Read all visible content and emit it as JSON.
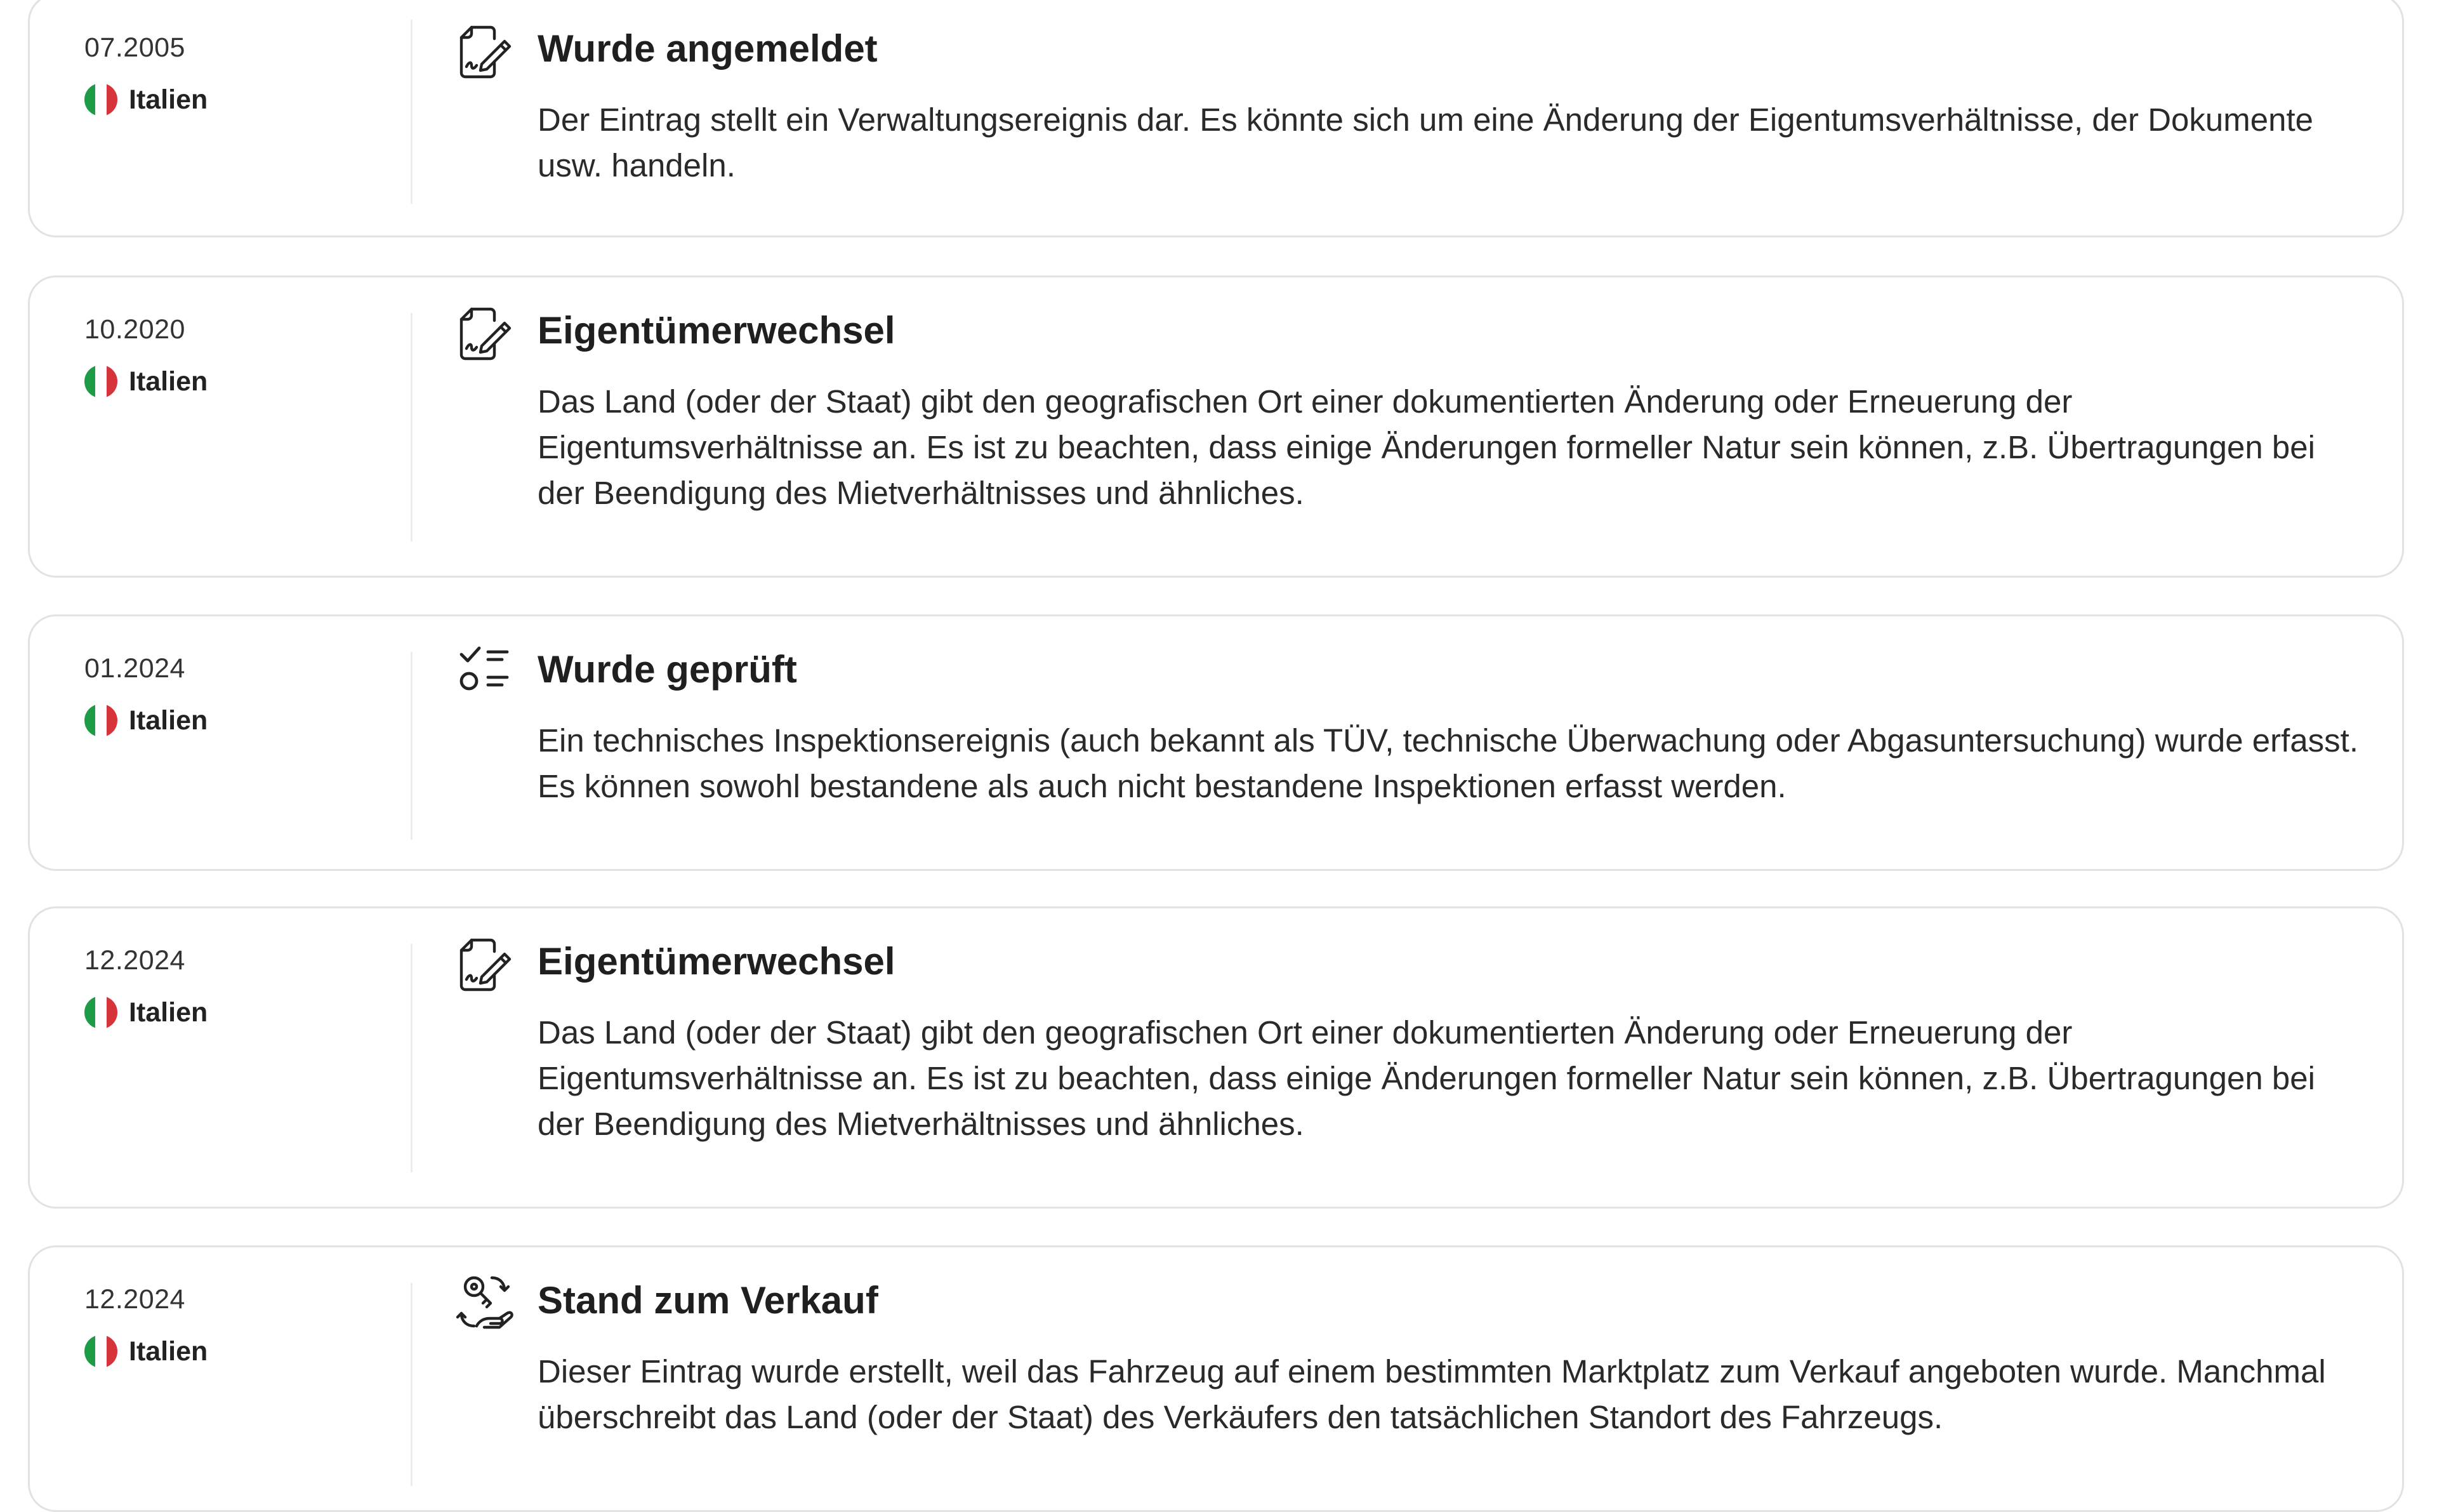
{
  "colors": {
    "border": "#e2e2e2",
    "divider": "#ececec",
    "flag_green": "#1e9b46",
    "flag_white": "#ffffff",
    "flag_red": "#d6333a",
    "text": "#222222"
  },
  "events": [
    {
      "date": "07.2005",
      "country": "Italien",
      "icon": "document-signature-icon",
      "title": "Wurde angemeldet",
      "description": "Der Eintrag stellt ein Verwaltungsereignis dar. Es könnte sich um eine Änderung der Eigentumsverhältnisse, der Dokumente usw. handeln."
    },
    {
      "date": "10.2020",
      "country": "Italien",
      "icon": "document-signature-icon",
      "title": "Eigentümerwechsel",
      "description": "Das Land (oder der Staat) gibt den geografischen Ort einer dokumentierten Änderung oder Erneuerung der Eigentumsverhältnisse an. Es ist zu beachten, dass einige Änderungen formeller Natur sein können, z.B. Übertragungen bei der Beendigung des Mietverhältnisses und ähnliches."
    },
    {
      "date": "01.2024",
      "country": "Italien",
      "icon": "checklist-icon",
      "title": "Wurde geprüft",
      "description": "Ein technisches Inspektionsereignis (auch bekannt als TÜV, technische Überwachung oder Abgasuntersuchung) wurde erfasst. Es können sowohl bestandene als auch nicht bestandene Inspektionen erfasst werden."
    },
    {
      "date": "12.2024",
      "country": "Italien",
      "icon": "document-signature-icon",
      "title": "Eigentümerwechsel",
      "description": "Das Land (oder der Staat) gibt den geografischen Ort einer dokumentierten Änderung oder Erneuerung der Eigentumsverhältnisse an. Es ist zu beachten, dass einige Änderungen formeller Natur sein können, z.B. Übertragungen bei der Beendigung des Mietverhältnisses und ähnliches."
    },
    {
      "date": "12.2024",
      "country": "Italien",
      "icon": "key-exchange-icon",
      "title": "Stand zum Verkauf",
      "description": "Dieser Eintrag wurde erstellt, weil das Fahrzeug auf einem bestimmten Marktplatz zum Verkauf angeboten wurde. Manchmal überschreibt das Land (oder der Staat) des Verkäufers den tatsächlichen Standort des Fahrzeugs."
    }
  ]
}
